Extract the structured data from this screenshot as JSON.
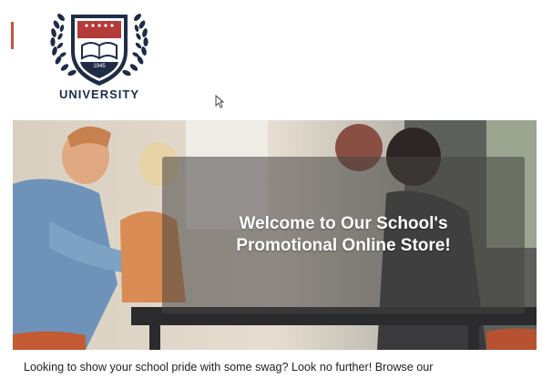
{
  "brand": {
    "logo_icon": "university-crest-icon",
    "logo_text": "UNIVERSITY",
    "crest_year": "1945",
    "colors": {
      "navy": "#1e2c47",
      "red": "#b53a3a",
      "accent": "#c8553d"
    }
  },
  "hero": {
    "image": "students-at-table-photo",
    "headline": "Welcome to Our School's Promotional Online Store!"
  },
  "intro": {
    "text": "Looking to show your school pride with some swag? Look no further! Browse our"
  }
}
